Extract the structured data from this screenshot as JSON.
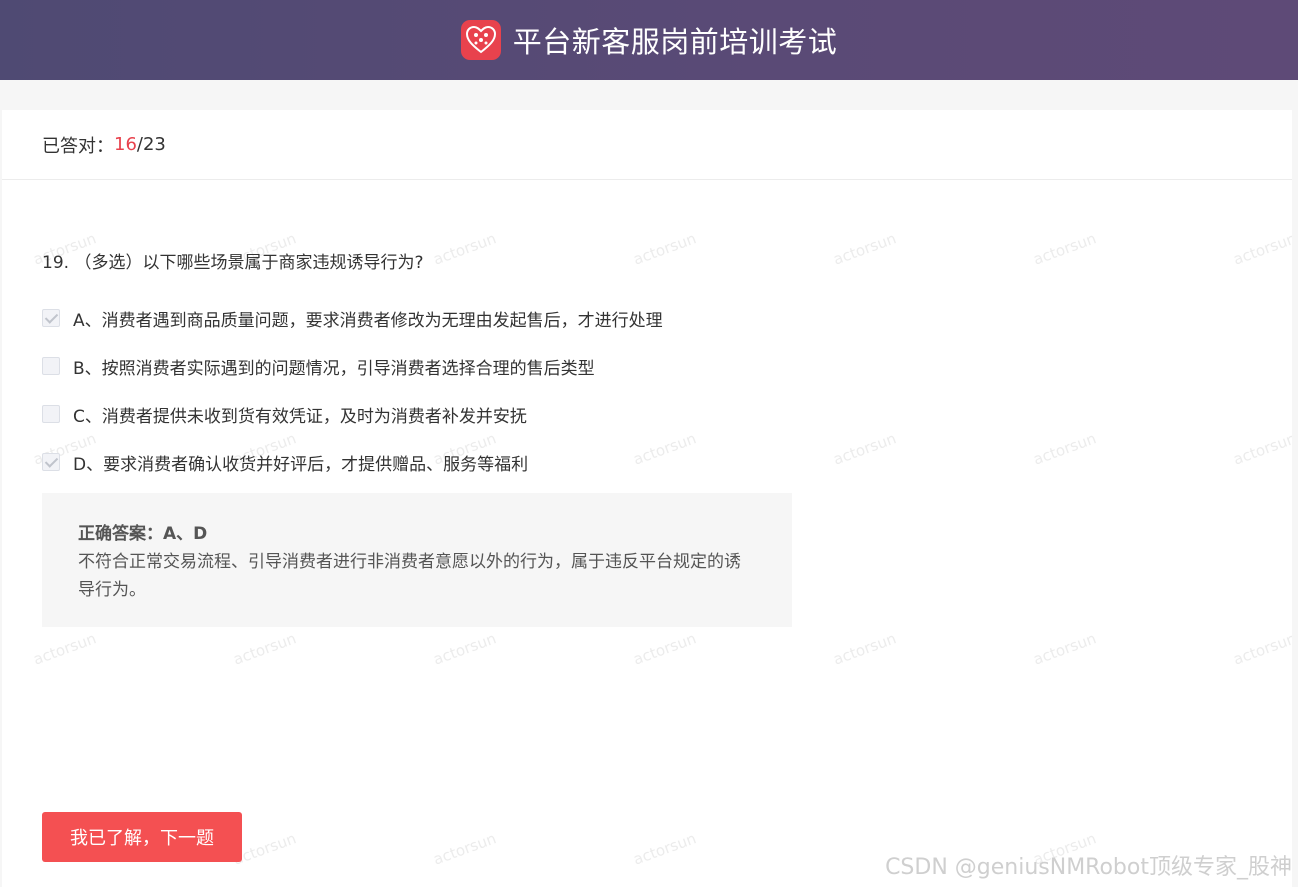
{
  "header": {
    "title": "平台新客服岗前培训考试",
    "logo_icon": "pinduoduo-logo-icon",
    "gradient": [
      "#4f4a73",
      "#5e4a77"
    ]
  },
  "score": {
    "label": "已答对：",
    "correct": "16",
    "separator": "/",
    "total": "23"
  },
  "question": {
    "text": "19. （多选）以下哪些场景属于商家违规诱导行为?",
    "options": [
      {
        "label": "A、消费者遇到商品质量问题，要求消费者修改为无理由发起售后，才进行处理",
        "checked": true
      },
      {
        "label": "B、按照消费者实际遇到的问题情况，引导消费者选择合理的售后类型",
        "checked": false
      },
      {
        "label": "C、消费者提供未收到货有效凭证，及时为消费者补发并安抚",
        "checked": false
      },
      {
        "label": "D、要求消费者确认收货并好评后，才提供赠品、服务等福利",
        "checked": true
      }
    ]
  },
  "answer": {
    "label": "正确答案：A、D",
    "explanation": "不符合正常交易流程、引导消费者进行非消费者意愿以外的行为，属于违反平台规定的诱导行为。"
  },
  "next_button": {
    "label": "我已了解，下一题",
    "color": "#f45052"
  },
  "watermark": "actorsun",
  "credit": "CSDN @geniusNMRobot顶级专家_股神",
  "colors": {
    "accent": "#e8424d"
  }
}
